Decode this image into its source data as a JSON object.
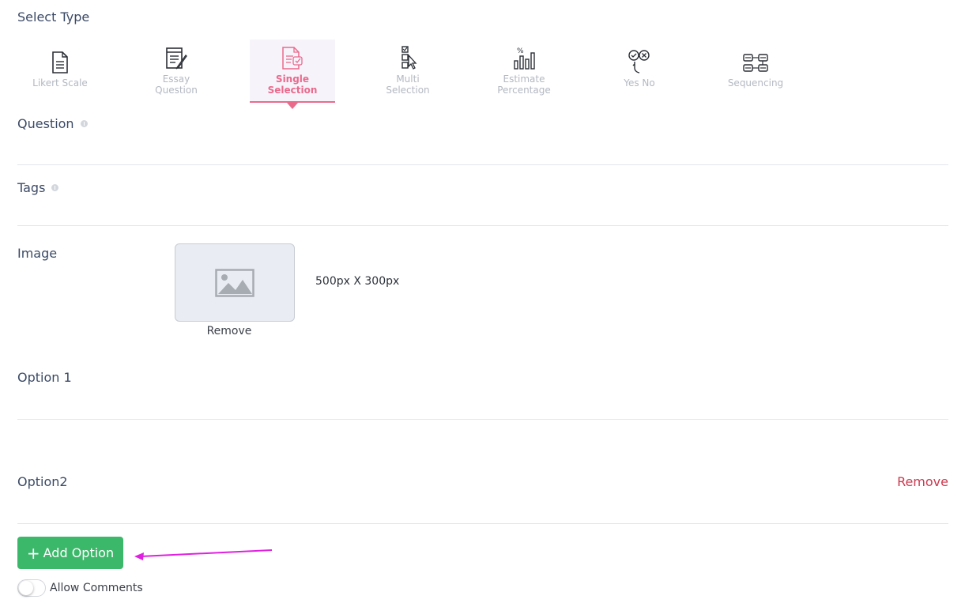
{
  "select_type": {
    "title": "Select Type",
    "items": [
      {
        "line1": "Likert Scale",
        "line2": "",
        "icon": "document-icon",
        "active": false
      },
      {
        "line1": "Essay",
        "line2": "Question",
        "icon": "essay-icon",
        "active": false
      },
      {
        "line1": "Single",
        "line2": "Selection",
        "icon": "single-selection-icon",
        "active": true
      },
      {
        "line1": "Multi",
        "line2": "Selection",
        "icon": "multi-selection-icon",
        "active": false
      },
      {
        "line1": "Estimate",
        "line2": "Percentage",
        "icon": "bar-chart-icon",
        "active": false
      },
      {
        "line1": "Yes No",
        "line2": "",
        "icon": "yes-no-icon",
        "active": false
      },
      {
        "line1": "Sequencing",
        "line2": "",
        "icon": "sequencing-icon",
        "active": false
      }
    ]
  },
  "question": {
    "label": "Question"
  },
  "tags": {
    "label": "Tags"
  },
  "image": {
    "label": "Image",
    "remove_label": "Remove",
    "size_hint": "500px X 300px"
  },
  "options": [
    {
      "label": "Option 1",
      "remove_label": ""
    },
    {
      "label": "Option2",
      "remove_label": "Remove"
    }
  ],
  "add_option": {
    "label": "Add Option",
    "plus": "+"
  },
  "allow_comments": {
    "label": "Allow Comments",
    "enabled": false
  },
  "colors": {
    "accent": "#ea6a8c",
    "button_green": "#3cb86a",
    "remove_red": "#c9394e",
    "arrow": "#e020e0"
  }
}
